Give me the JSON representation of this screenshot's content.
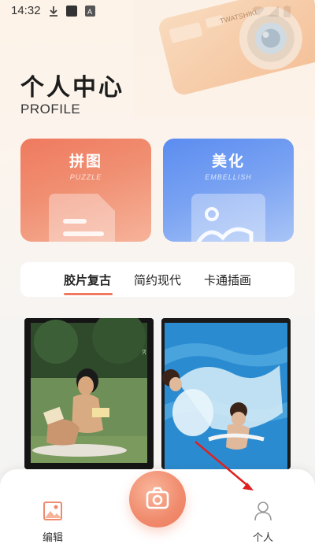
{
  "status_bar": {
    "time": "14:32"
  },
  "header": {
    "title": "个人中心",
    "subtitle": "PROFILE",
    "banner_text": "TWATSHIKI"
  },
  "cards": [
    {
      "title": "拼图",
      "subtitle": "PUZZLE",
      "icon": "document-icon",
      "color": "#ef7a5f"
    },
    {
      "title": "美化",
      "subtitle": "EMBELLISH",
      "icon": "image-icon",
      "color": "#5b8cf0"
    }
  ],
  "tabs": [
    {
      "label": "胶片复古",
      "active": true
    },
    {
      "label": "简约现代",
      "active": false
    },
    {
      "label": "卡通插画",
      "active": false
    }
  ],
  "bottom_nav": {
    "items": [
      {
        "label": "编辑",
        "icon": "image-icon"
      },
      {
        "label": "个人",
        "icon": "person-icon"
      }
    ],
    "center_icon": "camera-icon"
  },
  "colors": {
    "accent": "#ef7a5f",
    "blue": "#5b8cf0",
    "arrow": "#e02020"
  }
}
